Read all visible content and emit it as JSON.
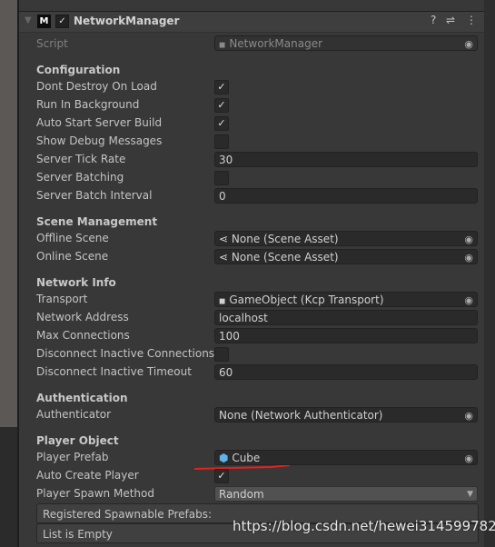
{
  "component": {
    "title": "NetworkManager",
    "enabled": true,
    "icons": [
      "help-icon",
      "presets-icon",
      "more-icon"
    ]
  },
  "script": {
    "label": "Script",
    "value": "NetworkManager"
  },
  "sections": {
    "configuration": "Configuration",
    "scene": "Scene Management",
    "network": "Network Info",
    "auth": "Authentication",
    "player": "Player Object"
  },
  "fields": {
    "dont_destroy": {
      "label": "Dont Destroy On Load",
      "checked": true
    },
    "run_bg": {
      "label": "Run In Background",
      "checked": true
    },
    "auto_start": {
      "label": "Auto Start Server Build",
      "checked": true
    },
    "show_debug": {
      "label": "Show Debug Messages",
      "checked": false
    },
    "tick_rate": {
      "label": "Server Tick Rate",
      "value": "30"
    },
    "batching": {
      "label": "Server Batching",
      "checked": false
    },
    "batch_interval": {
      "label": "Server Batch Interval",
      "value": "0"
    },
    "offline_scene": {
      "label": "Offline Scene",
      "value": "None (Scene Asset)"
    },
    "online_scene": {
      "label": "Online Scene",
      "value": "None (Scene Asset)"
    },
    "transport": {
      "label": "Transport",
      "value": "GameObject (Kcp Transport)"
    },
    "address": {
      "label": "Network Address",
      "value": "localhost"
    },
    "max_conn": {
      "label": "Max Connections",
      "value": "100"
    },
    "disconnect_inactive": {
      "label": "Disconnect Inactive Connections",
      "checked": false
    },
    "disconnect_timeout": {
      "label": "Disconnect Inactive Timeout",
      "value": "60"
    },
    "authenticator": {
      "label": "Authenticator",
      "value": "None (Network Authenticator)"
    },
    "player_prefab": {
      "label": "Player Prefab",
      "value": "Cube"
    },
    "auto_create": {
      "label": "Auto Create Player",
      "checked": true
    },
    "spawn_method": {
      "label": "Player Spawn Method",
      "value": "Random"
    }
  },
  "spawnables": {
    "header": "Registered Spawnable Prefabs:",
    "empty": "List is Empty"
  },
  "watermark": "https://blog.csdn.net/hewei314599782",
  "annotation_color": "#e8201c"
}
